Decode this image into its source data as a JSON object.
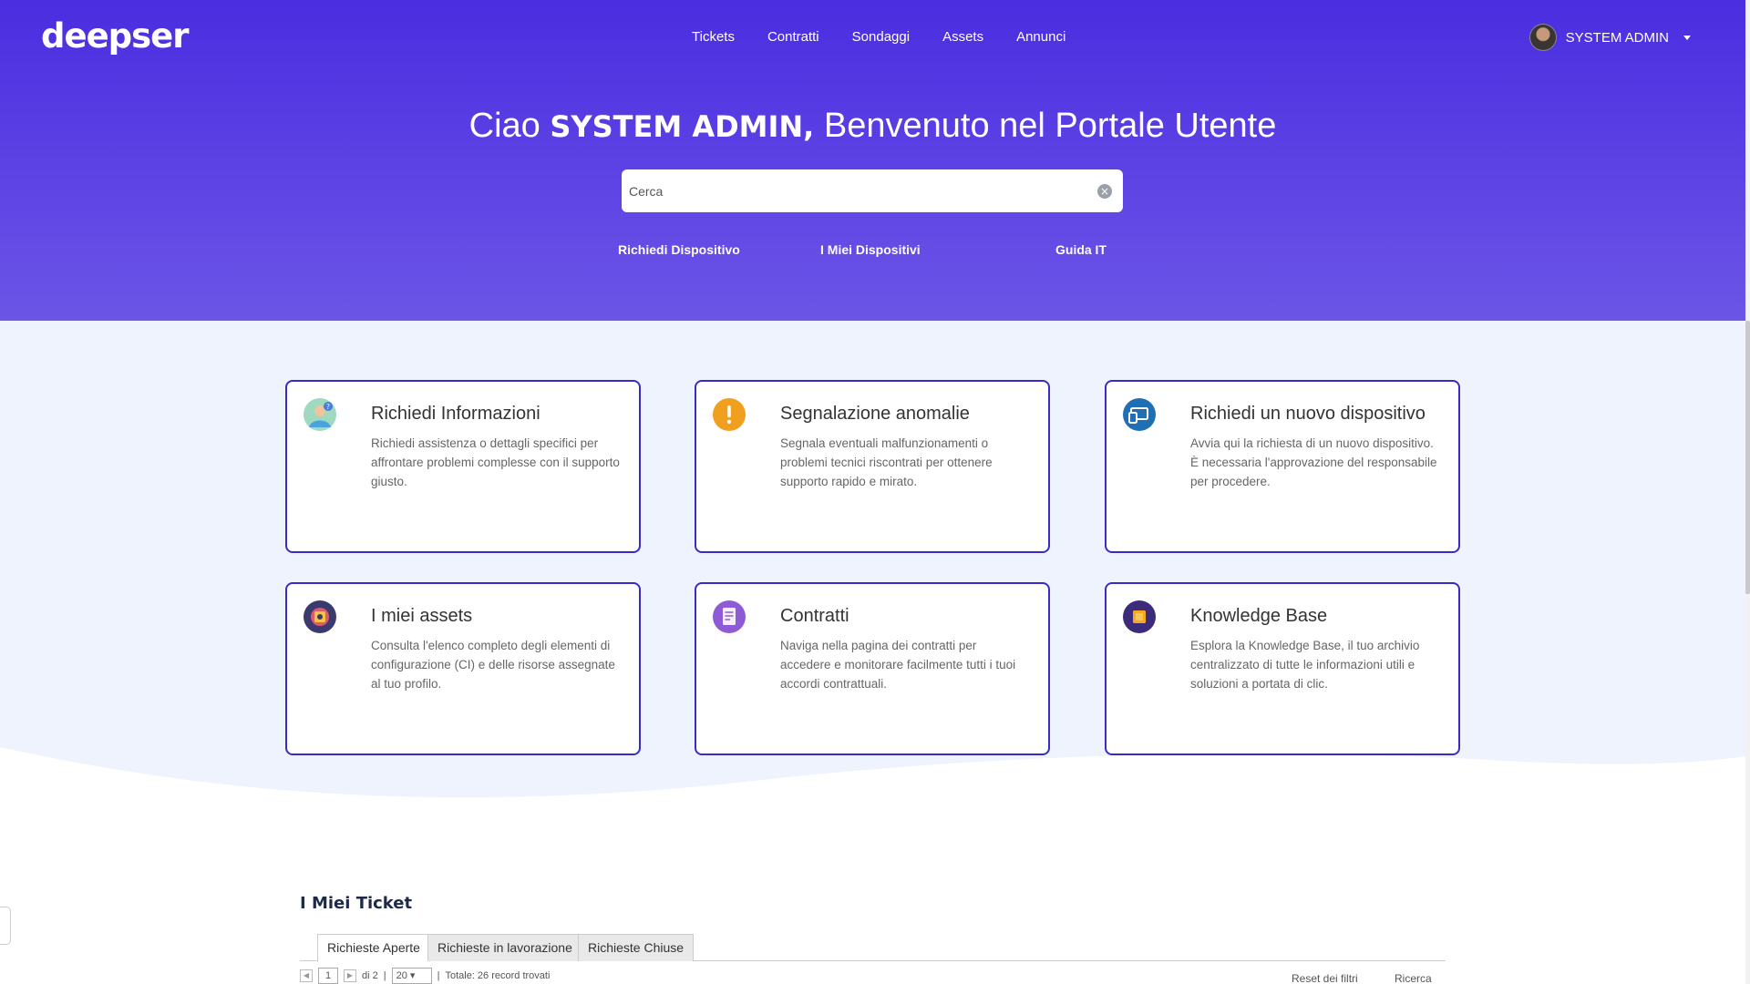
{
  "app": {
    "logo": "deepser",
    "nav": [
      "Tickets",
      "Contratti",
      "Sondaggi",
      "Assets",
      "Annunci"
    ],
    "user_name": "SYSTEM ADMIN"
  },
  "hero": {
    "greeting": "Ciao",
    "user": "SYSTEM ADMIN,",
    "welcome": "Benvenuto nel Portale Utente",
    "search_placeholder": "Cerca",
    "quick_links": [
      "Richiedi Dispositivo",
      "I Miei Dispositivi",
      "Guida IT"
    ]
  },
  "cards": [
    {
      "title": "Richiedi Informazioni",
      "text": "Richiedi assistenza o dettagli specifici per affrontare problemi complesse con il supporto giusto.",
      "icon": "person-question-icon",
      "color": "#7bc6a0"
    },
    {
      "title": "Segnalazione anomalie",
      "text": "Segnala eventuali malfunzionamenti o problemi tecnici riscontrati per ottenere supporto rapido e mirato.",
      "icon": "warning-icon",
      "color": "#f0a01e"
    },
    {
      "title": "Richiedi un nuovo dispositivo",
      "text": "Avvia qui la richiesta di un nuovo dispositivo. È necessaria l'approvazione del responsabile per procedere.",
      "icon": "devices-icon",
      "color": "#1f6fb5"
    },
    {
      "title": "I miei assets",
      "text": "Consulta l'elenco completo degli elementi di configurazione (CI) e delle risorse assegnate al tuo profilo.",
      "icon": "asset-icon",
      "color": "#3a3a6e"
    },
    {
      "title": "Contratti",
      "text": "Naviga nella pagina dei contratti per accedere e monitorare facilmente tutti i tuoi accordi contrattuali.",
      "icon": "contract-icon",
      "color": "#8f5ad6"
    },
    {
      "title": "Knowledge Base",
      "text": "Esplora la Knowledge Base, il tuo archivio centralizzato di tutte le informazioni utili e soluzioni a portata di clic.",
      "icon": "book-icon",
      "color": "#3b2b7a"
    }
  ],
  "tickets": {
    "title": "I Miei Ticket",
    "tabs": [
      "Richieste Aperte",
      "Richieste in lavorazione",
      "Richieste Chiuse"
    ],
    "page": "1",
    "of": "di 2",
    "per_page": "20",
    "total": "Totale: 26 record trovati",
    "reset": "Reset dei filtri",
    "search": "Ricerca"
  }
}
